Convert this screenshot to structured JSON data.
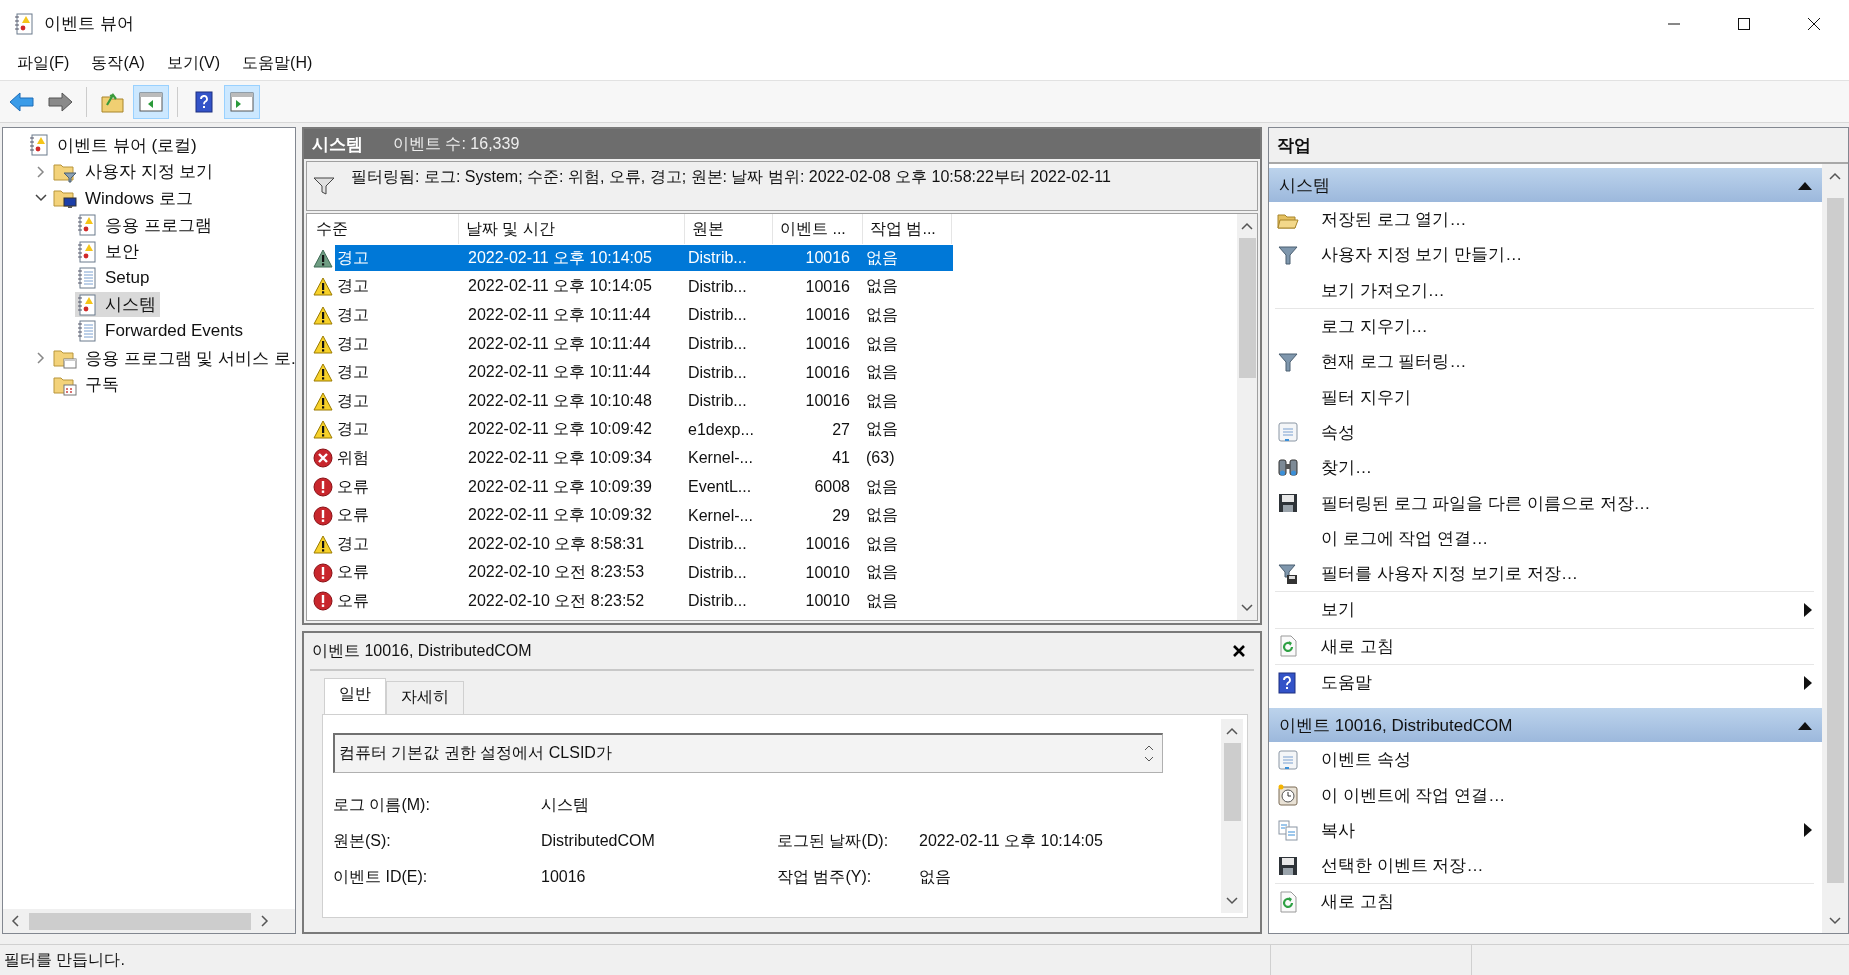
{
  "window": {
    "title": "이벤트 뷰어"
  },
  "menu": [
    "파일(F)",
    "동작(A)",
    "보기(V)",
    "도움말(H)"
  ],
  "toolbar": [
    {
      "kind": "back",
      "pressed": false
    },
    {
      "kind": "forward",
      "pressed": false
    },
    {
      "kind": "up",
      "pressed": false
    },
    {
      "kind": "tree",
      "pressed": true
    },
    {
      "kind": "help",
      "pressed": false
    },
    {
      "kind": "actions",
      "pressed": true
    }
  ],
  "tree": [
    {
      "label": "이벤트 뷰어 (로컬)",
      "kind": "log",
      "expandable": false,
      "selected": false,
      "children": [
        {
          "label": "사용자 지정 보기",
          "kind": "folder-filter",
          "expandable": true,
          "expanded": false,
          "selected": false
        },
        {
          "label": "Windows 로그",
          "kind": "folder-monitor",
          "expandable": true,
          "expanded": true,
          "selected": false,
          "children": [
            {
              "label": "응용 프로그램",
              "kind": "log",
              "expandable": false,
              "selected": false
            },
            {
              "label": "보안",
              "kind": "log",
              "expandable": false,
              "selected": false
            },
            {
              "label": "Setup",
              "kind": "notebook",
              "expandable": false,
              "selected": false
            },
            {
              "label": "시스템",
              "kind": "log",
              "expandable": false,
              "selected": true
            },
            {
              "label": "Forwarded Events",
              "kind": "notebook",
              "expandable": false,
              "selected": false
            }
          ]
        },
        {
          "label": "응용 프로그램 및 서비스 로.",
          "kind": "folder-window",
          "expandable": true,
          "expanded": false,
          "selected": false
        },
        {
          "label": "구독",
          "kind": "folder-calendar",
          "expandable": false,
          "selected": false
        }
      ]
    }
  ],
  "log_view": {
    "title": "시스템",
    "count": "이벤트 수: 16,339",
    "filter": "필터링됨: 로그: System; 수준: 위험, 오류, 경고; 원본: 날짜 범위: 2022-02-08 오후 10:58:22부터 2022-02-11",
    "columns": [
      "수준",
      "날짜 및 시간",
      "원본",
      "이벤트 ...",
      "작업 범..."
    ],
    "rows": [
      {
        "kind": "warning",
        "label": "경고",
        "date": "2022-02-11 오후 10:14:05",
        "source": "Distrib...",
        "event_id": "10016",
        "category": "없음",
        "selected": true
      },
      {
        "kind": "warning",
        "label": "경고",
        "date": "2022-02-11 오후 10:14:05",
        "source": "Distrib...",
        "event_id": "10016",
        "category": "없음",
        "selected": false
      },
      {
        "kind": "warning",
        "label": "경고",
        "date": "2022-02-11 오후 10:11:44",
        "source": "Distrib...",
        "event_id": "10016",
        "category": "없음",
        "selected": false
      },
      {
        "kind": "warning",
        "label": "경고",
        "date": "2022-02-11 오후 10:11:44",
        "source": "Distrib...",
        "event_id": "10016",
        "category": "없음",
        "selected": false
      },
      {
        "kind": "warning",
        "label": "경고",
        "date": "2022-02-11 오후 10:11:44",
        "source": "Distrib...",
        "event_id": "10016",
        "category": "없음",
        "selected": false
      },
      {
        "kind": "warning",
        "label": "경고",
        "date": "2022-02-11 오후 10:10:48",
        "source": "Distrib...",
        "event_id": "10016",
        "category": "없음",
        "selected": false
      },
      {
        "kind": "warning",
        "label": "경고",
        "date": "2022-02-11 오후 10:09:42",
        "source": "e1dexp...",
        "event_id": "27",
        "category": "없음",
        "selected": false
      },
      {
        "kind": "critical",
        "label": "위험",
        "date": "2022-02-11 오후 10:09:34",
        "source": "Kernel-...",
        "event_id": "41",
        "category": "(63)",
        "selected": false
      },
      {
        "kind": "error",
        "label": "오류",
        "date": "2022-02-11 오후 10:09:39",
        "source": "EventL...",
        "event_id": "6008",
        "category": "없음",
        "selected": false
      },
      {
        "kind": "error",
        "label": "오류",
        "date": "2022-02-11 오후 10:09:32",
        "source": "Kernel-...",
        "event_id": "29",
        "category": "없음",
        "selected": false
      },
      {
        "kind": "warning",
        "label": "경고",
        "date": "2022-02-10 오후 8:58:31",
        "source": "Distrib...",
        "event_id": "10016",
        "category": "없음",
        "selected": false
      },
      {
        "kind": "error",
        "label": "오류",
        "date": "2022-02-10 오전 8:23:53",
        "source": "Distrib...",
        "event_id": "10010",
        "category": "없음",
        "selected": false
      },
      {
        "kind": "error",
        "label": "오류",
        "date": "2022-02-10 오전 8:23:52",
        "source": "Distrib...",
        "event_id": "10010",
        "category": "없음",
        "selected": false
      }
    ]
  },
  "detail": {
    "title": "이벤트 10016, DistributedCOM",
    "tabs": [
      {
        "label": "일반",
        "selected": true
      },
      {
        "label": "자세히",
        "selected": false
      }
    ],
    "description": "컴퓨터 기본값 권한 설정에서 CLSID가",
    "fields": [
      [
        {
          "label": "로그 이름(M):",
          "value": "시스템"
        }
      ],
      [
        {
          "label": "원본(S):",
          "value": "DistributedCOM"
        },
        {
          "label": "로그된 날짜(D):",
          "value": "2022-02-11 오후 10:14:05"
        }
      ],
      [
        {
          "label": "이벤트 ID(E):",
          "value": "10016"
        },
        {
          "label": "작업 범주(Y):",
          "value": "없음"
        }
      ]
    ]
  },
  "actions": {
    "title": "작업",
    "groups": [
      {
        "title": "시스템",
        "expanded": true,
        "sections": [
          [
            {
              "label": "저장된 로그 열기…",
              "submenu": false
            },
            {
              "label": "사용자 지정 보기 만들기…",
              "submenu": false
            },
            {
              "label": "보기 가져오기…",
              "submenu": false
            }
          ],
          [
            {
              "label": "로그 지우기…",
              "submenu": false
            },
            {
              "label": "현재 로그 필터링…",
              "submenu": false
            },
            {
              "label": "필터 지우기",
              "submenu": false
            },
            {
              "label": "속성",
              "submenu": false
            },
            {
              "label": "찾기…",
              "submenu": false
            },
            {
              "label": "필터링된 로그 파일을 다른 이름으로 저장…",
              "submenu": false
            },
            {
              "label": "이 로그에 작업 연결…",
              "submenu": false
            },
            {
              "label": "필터를 사용자 지정 보기로 저장…",
              "submenu": false
            }
          ],
          [
            {
              "label": "보기",
              "submenu": true
            }
          ],
          [
            {
              "label": "새로 고침",
              "submenu": false
            }
          ],
          [
            {
              "label": "도움말",
              "submenu": true
            }
          ]
        ]
      },
      {
        "title": "이벤트 10016, DistributedCOM",
        "expanded": true,
        "sections": [
          [
            {
              "label": "이벤트 속성",
              "submenu": false
            },
            {
              "label": "이 이벤트에 작업 연결…",
              "submenu": false
            },
            {
              "label": "복사",
              "submenu": true
            },
            {
              "label": "선택한 이벤트 저장…",
              "submenu": false
            }
          ],
          [
            {
              "label": "새로 고침",
              "submenu": false
            }
          ]
        ]
      }
    ]
  },
  "status_bar": "필터를 만듭니다."
}
